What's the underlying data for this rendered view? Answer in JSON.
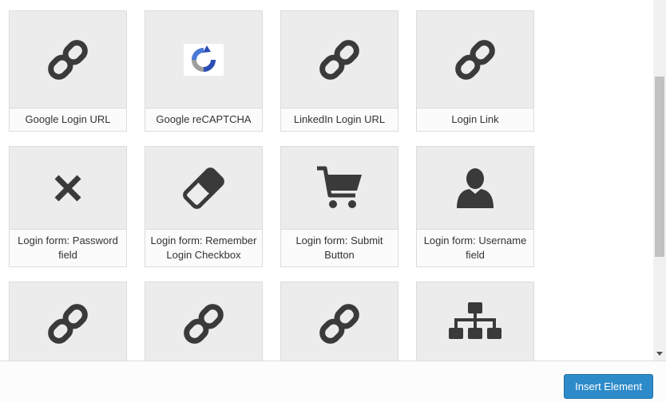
{
  "elements": [
    {
      "label": "Google Login URL",
      "icon": "link-icon"
    },
    {
      "label": "Google reCAPTCHA",
      "icon": "recaptcha-icon"
    },
    {
      "label": "LinkedIn Login URL",
      "icon": "link-icon"
    },
    {
      "label": "Login Link",
      "icon": "link-icon"
    },
    {
      "label": "Login form: Password field",
      "icon": "close-x-icon"
    },
    {
      "label": "Login form: Remember Login Checkbox",
      "icon": "eraser-icon"
    },
    {
      "label": "Login form: Submit Button",
      "icon": "shopping-cart-icon"
    },
    {
      "label": "Login form: Username field",
      "icon": "user-icon"
    },
    {
      "label": "",
      "icon": "link-icon"
    },
    {
      "label": "",
      "icon": "link-icon"
    },
    {
      "label": "",
      "icon": "link-icon"
    },
    {
      "label": "",
      "icon": "sitemap-icon"
    }
  ],
  "footer": {
    "insert_label": "Insert Element"
  },
  "colors": {
    "icon": "#3a3a3a",
    "button": "#2e8bc9"
  }
}
